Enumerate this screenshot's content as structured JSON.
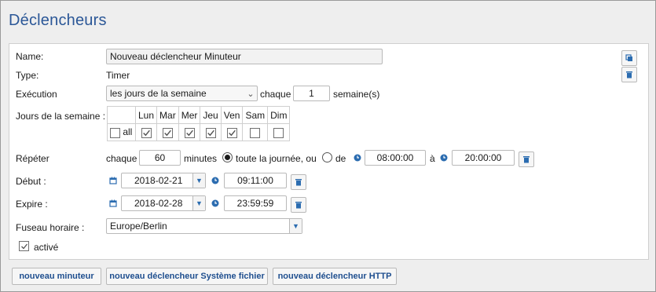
{
  "title": "Déclencheurs",
  "form": {
    "name_label": "Name:",
    "name_value": "Nouveau déclencheur Minuteur",
    "type_label": "Type:",
    "type_value": "Timer",
    "execution_label": "Exécution",
    "execution_value": "les jours de la semaine",
    "every_label": "chaque",
    "weeks_value": "1",
    "weeks_unit": "semaine(s)",
    "days_label": "Jours de la semaine :",
    "days": [
      {
        "label": "Lun",
        "checked": true
      },
      {
        "label": "Mar",
        "checked": true
      },
      {
        "label": "Mer",
        "checked": true
      },
      {
        "label": "Jeu",
        "checked": true
      },
      {
        "label": "Ven",
        "checked": true
      },
      {
        "label": "Sam",
        "checked": false
      },
      {
        "label": "Dim",
        "checked": false
      }
    ],
    "all_label": "all",
    "repeat_label": "Répéter",
    "repeat_every": "chaque",
    "repeat_minutes": "60",
    "minutes_label": "minutes",
    "all_day_label": "toute la journée, ou",
    "from_label": "de",
    "from_time": "08:00:00",
    "to_label": "à",
    "to_time": "20:00:00",
    "start_label": "Début :",
    "start_date": "2018-02-21",
    "start_time": "09:11:00",
    "expire_label": "Expire :",
    "expire_date": "2018-02-28",
    "expire_time": "23:59:59",
    "timezone_label": "Fuseau horaire :",
    "timezone_value": "Europe/Berlin",
    "active_label": "activé"
  },
  "buttons": {
    "new_timer": "nouveau minuteur",
    "new_fs_trigger": "nouveau déclencheur Système fichier",
    "new_http_trigger": "nouveau déclencheur HTTP"
  },
  "colors": {
    "heading": "#2b5797",
    "accent_icon": "#2b6cb0",
    "button_text": "#1f4f8f"
  },
  "icons": [
    "copy-icon",
    "trash-icon",
    "calendar-icon",
    "clock-icon",
    "chevron-down-icon",
    "checkbox-check-icon"
  ]
}
